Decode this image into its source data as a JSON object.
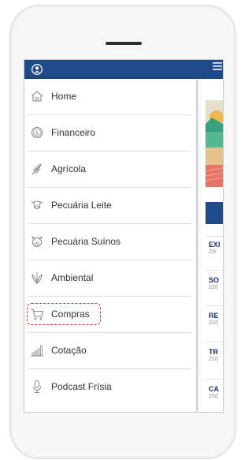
{
  "menu": {
    "items": [
      {
        "label": "Home",
        "icon": "home-icon"
      },
      {
        "label": "Financeiro",
        "icon": "dollar-coin-icon"
      },
      {
        "label": "Agrícola",
        "icon": "wheat-icon"
      },
      {
        "label": "Pecuária Leite",
        "icon": "cow-icon"
      },
      {
        "label": "Pecuária Suínos",
        "icon": "pig-icon"
      },
      {
        "label": "Ambiental",
        "icon": "leaves-icon"
      },
      {
        "label": "Compras",
        "icon": "shopping-cart-icon"
      },
      {
        "label": "Cotação",
        "icon": "bar-chart-icon"
      },
      {
        "label": "Podcast Frísia",
        "icon": "microphone-icon"
      }
    ]
  },
  "news": [
    {
      "title": "EXI",
      "date": "23/"
    },
    {
      "title": "SO",
      "date": "22/("
    },
    {
      "title": "RE",
      "date": "22/("
    },
    {
      "title": "TR",
      "date": "21/("
    },
    {
      "title": "CA",
      "date": "15/("
    }
  ],
  "colors": {
    "header": "#1e4a8a",
    "highlight": "#d62b2b",
    "news_title": "#1c2f6b"
  }
}
